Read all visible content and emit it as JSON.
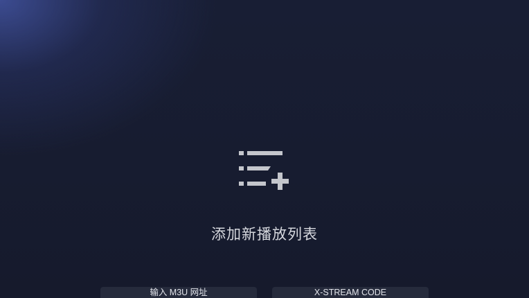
{
  "empty_state": {
    "icon": "playlist-add-icon",
    "title": "添加新播放列表"
  },
  "actions": {
    "m3u_label": "输入 M3U 网址",
    "xstream_label": "X-STREAM CODE"
  },
  "colors": {
    "background": "#171c30",
    "glow": "#3e4e96",
    "icon": "#c4c6cc",
    "button": "#262b3c"
  }
}
